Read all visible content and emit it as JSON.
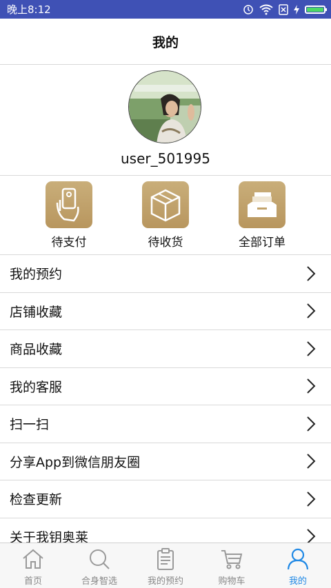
{
  "status": {
    "time": "晚上8:12"
  },
  "header": {
    "title": "我的"
  },
  "profile": {
    "username": "user_501995"
  },
  "orders": [
    {
      "label": "待支付",
      "icon": "pay-icon"
    },
    {
      "label": "待收货",
      "icon": "box-icon"
    },
    {
      "label": "全部订单",
      "icon": "orders-icon"
    }
  ],
  "menu": [
    {
      "label": "我的预约"
    },
    {
      "label": "店铺收藏"
    },
    {
      "label": "商品收藏"
    },
    {
      "label": "我的客服"
    },
    {
      "label": "扫一扫"
    },
    {
      "label": "分享App到微信朋友圈"
    },
    {
      "label": "检查更新"
    },
    {
      "label": "关于我钥奥莱"
    }
  ],
  "tabs": [
    {
      "label": "首页",
      "icon": "home-icon"
    },
    {
      "label": "合身智选",
      "icon": "search-icon"
    },
    {
      "label": "我的预约",
      "icon": "clipboard-icon"
    },
    {
      "label": "购物车",
      "icon": "cart-icon"
    },
    {
      "label": "我的",
      "icon": "user-icon",
      "active": true
    }
  ],
  "colors": {
    "statusbar": "#3f51b5",
    "accent": "#1e88e5",
    "gold": "#c2a36b"
  }
}
